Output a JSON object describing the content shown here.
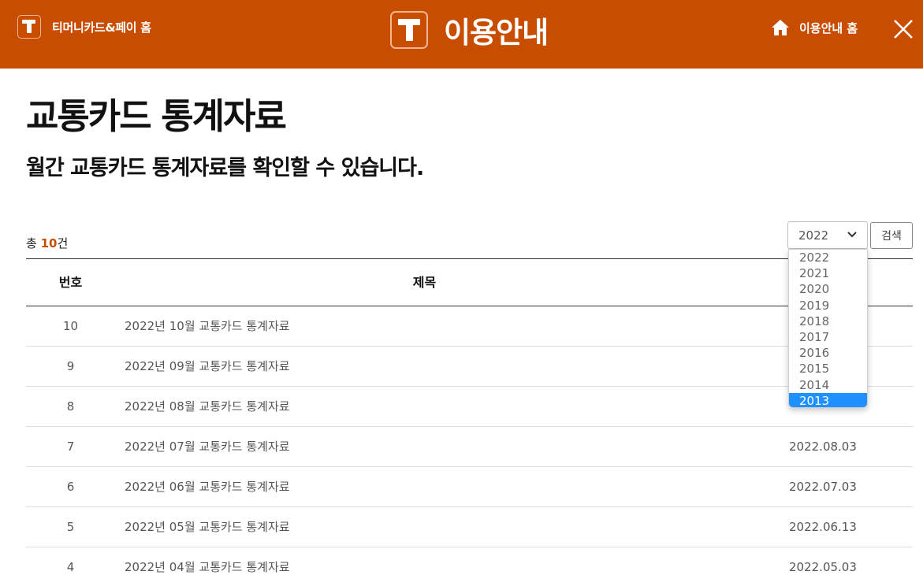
{
  "header": {
    "home_label": "티머니카드&페이 홈",
    "title": "이용안내",
    "guide_home_label": "이용안내 홈",
    "brand_color": "#c94d00"
  },
  "page": {
    "title": "교통카드 통계자료",
    "subtitle": "월간 교통카드 통계자료를 확인할 수 있습니다."
  },
  "summary": {
    "prefix": "총 ",
    "count": "10",
    "suffix": "건"
  },
  "filter": {
    "selected_year": "2022",
    "options": [
      "2022",
      "2021",
      "2020",
      "2019",
      "2018",
      "2017",
      "2016",
      "2015",
      "2014",
      "2013"
    ],
    "highlighted_option": "2013",
    "search_label": "검색"
  },
  "table": {
    "headers": {
      "no": "번호",
      "title": "제목"
    },
    "rows": [
      {
        "no": "10",
        "title": "2022년 10월 교통카드 통계자료",
        "date": ""
      },
      {
        "no": "9",
        "title": "2022년 09월 교통카드 통계자료",
        "date": ""
      },
      {
        "no": "8",
        "title": "2022년 08월 교통카드 통계자료",
        "date": ""
      },
      {
        "no": "7",
        "title": "2022년 07월 교통카드 통계자료",
        "date": "2022.08.03"
      },
      {
        "no": "6",
        "title": "2022년 06월 교통카드 통계자료",
        "date": "2022.07.03"
      },
      {
        "no": "5",
        "title": "2022년 05월 교통카드 통계자료",
        "date": "2022.06.13"
      },
      {
        "no": "4",
        "title": "2022년 04월 교통카드 통계자료",
        "date": "2022.05.03"
      }
    ]
  }
}
